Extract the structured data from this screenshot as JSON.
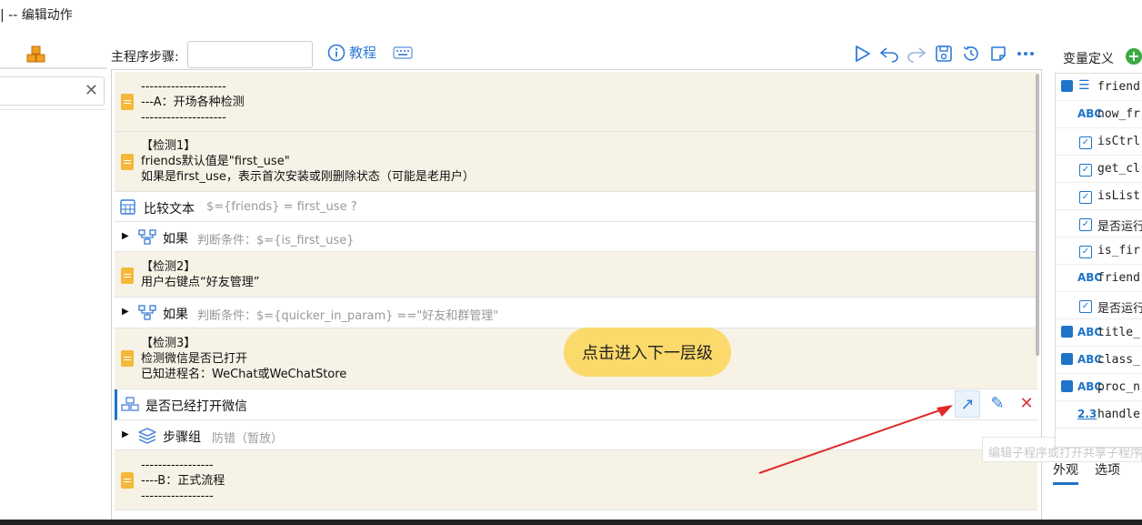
{
  "window": {
    "title": "| -- 编辑动作"
  },
  "left": {
    "clear_symbol": "✕"
  },
  "toolbar": {
    "step_label": "主程序步骤:",
    "step_input_value": "",
    "tutorial_label": "教程",
    "icons": [
      "run-icon",
      "undo-icon",
      "redo-icon",
      "save-icon",
      "history-icon",
      "note-icon",
      "more-icon"
    ]
  },
  "steps": [
    {
      "kind": "note",
      "lines": "--------------------\n---A：开场各种检测\n--------------------"
    },
    {
      "kind": "note",
      "lines": "【检测1】\nfriends默认值是\"first_use\"\n如果是first_use，表示首次安装或刚删除状态（可能是老用户）"
    },
    {
      "kind": "action",
      "title": "比较文本",
      "hint": "$={friends} =  first_use ?"
    },
    {
      "kind": "if",
      "title": "如果",
      "hint": "判断条件：$={is_first_use}"
    },
    {
      "kind": "note",
      "lines": "【检测2】\n用户右键点“好友管理”"
    },
    {
      "kind": "if",
      "title": "如果",
      "hint": "判断条件：$={quicker_in_param} ==\"好友和群管理\""
    },
    {
      "kind": "note",
      "lines": "【检测3】\n检测微信是否已打开\n已知进程名：WeChat或WeChatStore"
    },
    {
      "kind": "subprogram",
      "title": "是否已经打开微信",
      "hint": ""
    },
    {
      "kind": "group",
      "title": "步骤组",
      "hint": "防错（暂放）"
    },
    {
      "kind": "note",
      "lines": "-----------------\n----B：正式流程\n-----------------"
    }
  ],
  "callout": {
    "text": "点击进入下一层级"
  },
  "row_actions": {
    "open": "↗",
    "edit": "✎",
    "delete": "✕"
  },
  "tooltip": {
    "text": "编辑子程序或打开共享子程序"
  },
  "variables": {
    "title": "变量定义",
    "add_symbol": "+",
    "items": [
      {
        "icons": "save+list",
        "name": "friend"
      },
      {
        "icons": "abc",
        "name": "now_fr"
      },
      {
        "icons": "check",
        "name": "isCtrl"
      },
      {
        "icons": "check",
        "name": "get_cl"
      },
      {
        "icons": "check",
        "name": "isList"
      },
      {
        "icons": "check",
        "name": "是否运行"
      },
      {
        "icons": "check",
        "name": "is_fir"
      },
      {
        "icons": "abc",
        "name": "friend"
      },
      {
        "icons": "check",
        "name": "是否运行"
      },
      {
        "icons": "save+abc",
        "name": "title_"
      },
      {
        "icons": "save+abc",
        "name": "class_"
      },
      {
        "icons": "save+abc",
        "name": "proc_n"
      },
      {
        "icons": "num",
        "name": "handle"
      }
    ],
    "tabs": [
      "外观",
      "选项"
    ]
  },
  "colors": {
    "accent": "#1e74c8",
    "note_bg": "#f6f2e6",
    "callout": "#fbd96a",
    "arrow": "#e02a2a"
  }
}
